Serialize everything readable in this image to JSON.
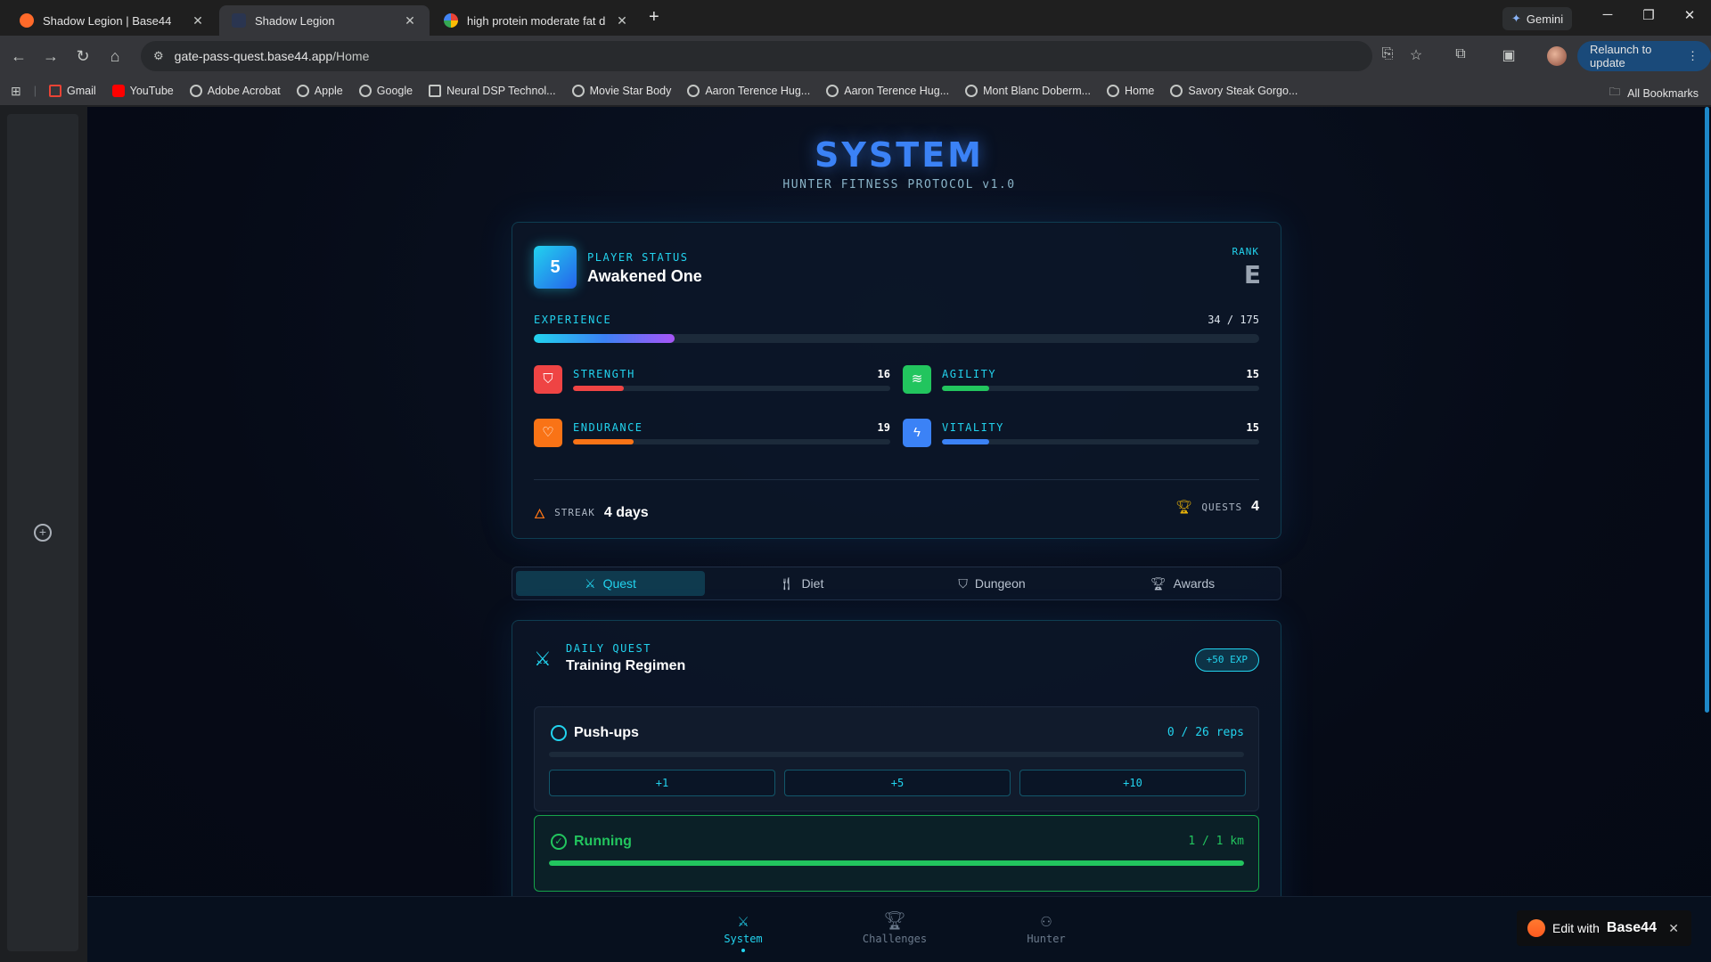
{
  "browser": {
    "tabs": [
      {
        "title": "Shadow Legion | Base44",
        "active": false
      },
      {
        "title": "Shadow Legion",
        "active": true
      },
      {
        "title": "high protein moderate fat diet",
        "active": false
      }
    ],
    "new_tab": "+",
    "gemini": "Gemini",
    "url_host": "gate-pass-quest.base44.app",
    "url_path": "/Home",
    "relaunch": "Relaunch to update",
    "bookmarks": [
      "Gmail",
      "YouTube",
      "Adobe Acrobat",
      "Apple",
      "Google",
      "Neural DSP Technol...",
      "Movie Star Body",
      "Aaron Terence Hug...",
      "Aaron Terence Hug...",
      "Mont Blanc Doberm...",
      "Home",
      "Savory Steak Gorgo..."
    ],
    "all_bookmarks": "All Bookmarks"
  },
  "app": {
    "title": "SYSTEM",
    "subtitle": "HUNTER FITNESS PROTOCOL v1.0",
    "player": {
      "level": "5",
      "status_label": "PLAYER STATUS",
      "name": "Awakened One",
      "rank_label": "RANK",
      "rank": "E",
      "exp_label": "EXPERIENCE",
      "exp_text": "34 / 175",
      "exp_fraction": 0.194
    },
    "stats": [
      {
        "name": "STRENGTH",
        "value": "16",
        "fraction": 0.16,
        "color": "#ef4444",
        "icon": "shield-icon"
      },
      {
        "name": "AGILITY",
        "value": "15",
        "fraction": 0.15,
        "color": "#22c55e",
        "icon": "wind-icon"
      },
      {
        "name": "ENDURANCE",
        "value": "19",
        "fraction": 0.19,
        "color": "#f97316",
        "icon": "heart-icon"
      },
      {
        "name": "VITALITY",
        "value": "15",
        "fraction": 0.15,
        "color": "#3b82f6",
        "icon": "bolt-icon"
      }
    ],
    "streak": {
      "label": "STREAK",
      "value": "4 days"
    },
    "quests": {
      "label": "QUESTS",
      "value": "4"
    },
    "tabs": [
      {
        "label": "Quest",
        "icon": "swords-icon",
        "active": true
      },
      {
        "label": "Diet",
        "icon": "utensils-icon",
        "active": false
      },
      {
        "label": "Dungeon",
        "icon": "shield-icon",
        "active": false
      },
      {
        "label": "Awards",
        "icon": "trophy-icon",
        "active": false
      }
    ],
    "daily_quest": {
      "label": "DAILY QUEST",
      "title": "Training Regimen",
      "badge": "+50 EXP",
      "tasks": [
        {
          "name": "Push-ups",
          "progress_text": "0 / 26 reps",
          "fraction": 0.0,
          "done": false,
          "buttons": [
            "+1",
            "+5",
            "+10"
          ]
        },
        {
          "name": "Running",
          "progress_text": "1 / 1 km",
          "fraction": 1.0,
          "done": true
        }
      ]
    },
    "bottom_nav": [
      {
        "label": "System",
        "icon": "swords-icon",
        "active": true
      },
      {
        "label": "Challenges",
        "icon": "trophy-icon",
        "active": false
      },
      {
        "label": "Hunter",
        "icon": "user-icon",
        "active": false
      }
    ],
    "edit_badge": {
      "prefix": "Edit with",
      "brand": "Base44",
      "close": "✕"
    }
  }
}
